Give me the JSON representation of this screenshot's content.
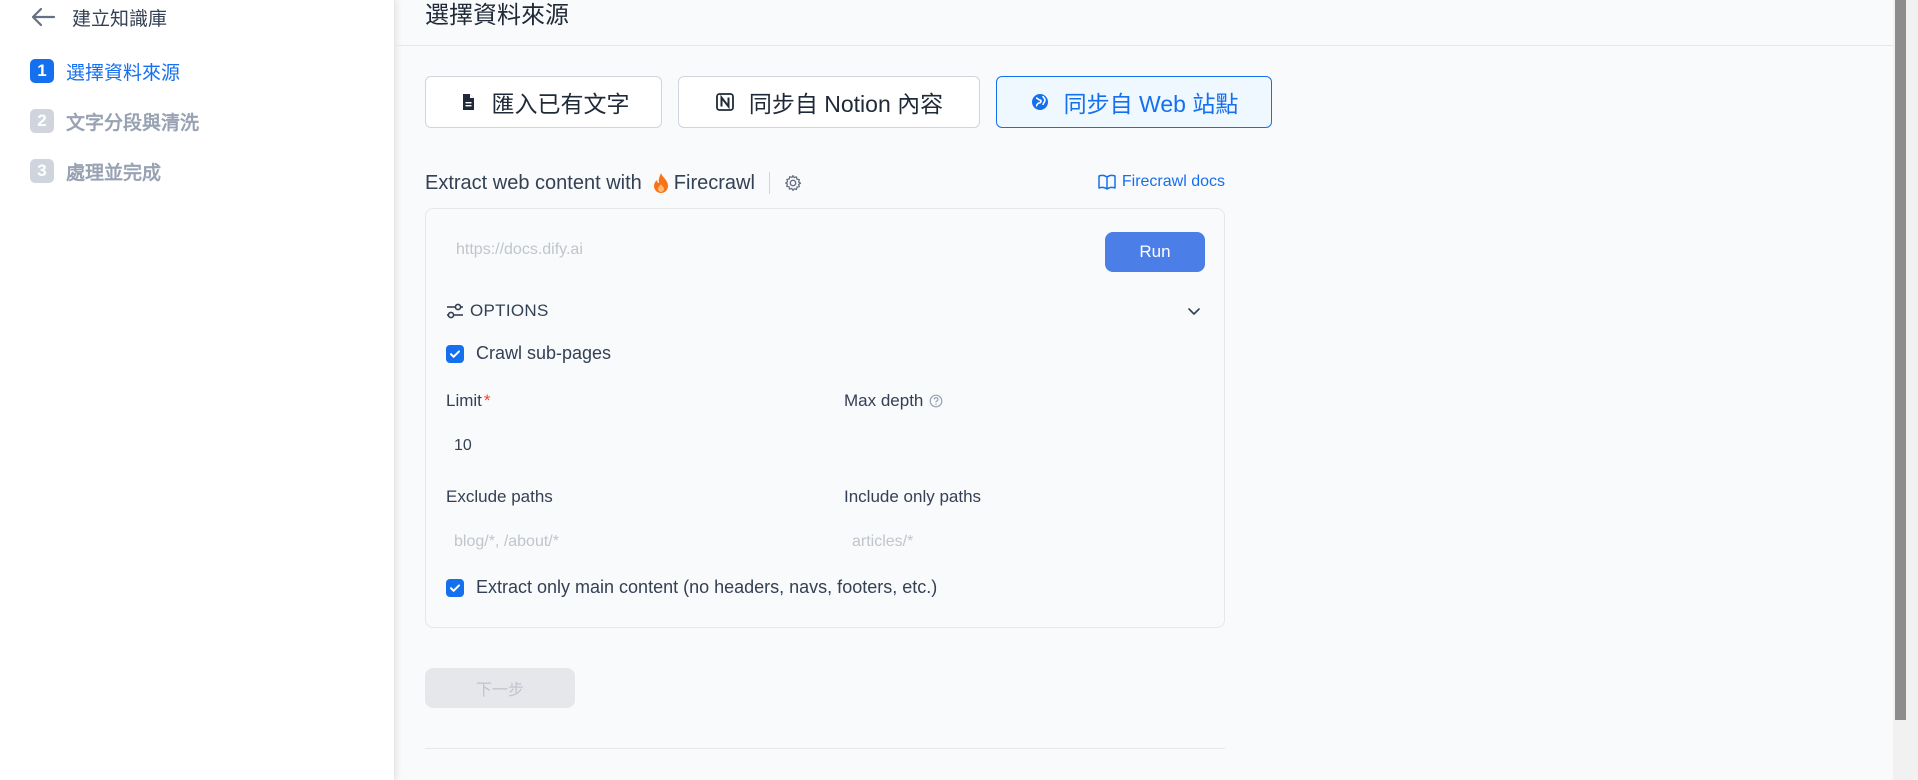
{
  "sidebar": {
    "back_label": "建立知識庫",
    "steps": [
      {
        "num": "1",
        "label": "選擇資料來源",
        "active": true
      },
      {
        "num": "2",
        "label": "文字分段與清洗",
        "active": false
      },
      {
        "num": "3",
        "label": "處理並完成",
        "active": false
      }
    ]
  },
  "main": {
    "title": "選擇資料來源",
    "tabs": [
      {
        "label": "匯入已有文字",
        "icon": "file-icon"
      },
      {
        "label": "同步自 Notion 內容",
        "icon": "notion-icon"
      },
      {
        "label": "同步自 Web 站點",
        "icon": "globe-icon",
        "selected": true
      }
    ],
    "extract_text": "Extract web content with",
    "provider_name": "Firecrawl",
    "docs_link": "Firecrawl docs",
    "url_placeholder": "https://docs.dify.ai",
    "run_label": "Run",
    "options_label": "OPTIONS",
    "crawl_sub_pages_label": "Crawl sub-pages",
    "limit_label": "Limit",
    "limit_required": "*",
    "limit_value": "10",
    "max_depth_label": "Max depth",
    "exclude_paths_label": "Exclude paths",
    "exclude_paths_placeholder": "blog/*, /about/*",
    "include_paths_label": "Include only paths",
    "include_paths_placeholder": "articles/*",
    "extract_main_label": "Extract only main content (no headers, navs, footers, etc.)",
    "next_label": "下一步"
  },
  "colors": {
    "accent": "#1570ef",
    "run_button": "#4c7ee8",
    "firecrawl_flame": "#f97316"
  }
}
